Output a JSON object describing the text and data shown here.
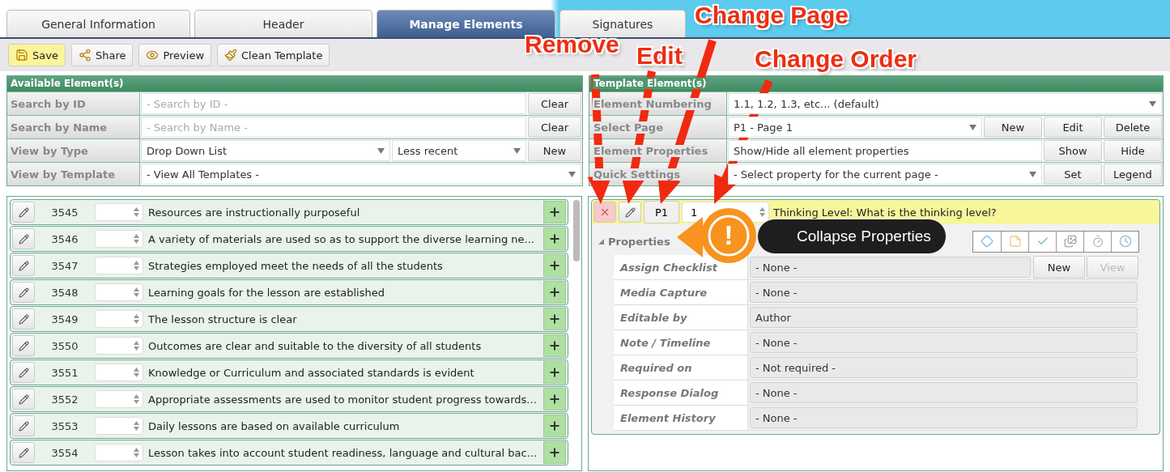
{
  "tabs": [
    {
      "label": "General Information",
      "selected": false
    },
    {
      "label": "Header",
      "selected": false
    },
    {
      "label": "Manage Elements",
      "selected": true
    },
    {
      "label": "Signatures",
      "selected": false
    }
  ],
  "toolbar": [
    {
      "label": "Save",
      "kind": "save",
      "highlighted": true
    },
    {
      "label": "Share",
      "kind": "share",
      "highlighted": false
    },
    {
      "label": "Preview",
      "kind": "preview",
      "highlighted": false
    },
    {
      "label": "Clean Template",
      "kind": "clean",
      "highlighted": false
    }
  ],
  "available": {
    "title": "Available Element(s)",
    "rows": [
      {
        "label": "Search by ID",
        "controls": [
          {
            "kind": "input",
            "placeholder": "- Search by ID -"
          },
          {
            "kind": "button",
            "label": "Clear"
          }
        ]
      },
      {
        "label": "Search by Name",
        "controls": [
          {
            "kind": "input",
            "placeholder": "- Search by Name -"
          },
          {
            "kind": "button",
            "label": "Clear"
          }
        ]
      },
      {
        "label": "View by Type",
        "controls": [
          {
            "kind": "select",
            "value": "Drop Down List"
          },
          {
            "kind": "select-narrow",
            "value": "Less recent"
          },
          {
            "kind": "button",
            "label": "New"
          }
        ]
      },
      {
        "label": "View by Template",
        "controls": [
          {
            "kind": "select",
            "value": "- View All Templates -"
          }
        ]
      }
    ]
  },
  "template": {
    "title": "Template Element(s)",
    "rows": [
      {
        "label": "Element Numbering",
        "controls": [
          {
            "kind": "select",
            "value": "1.1, 1.2, 1.3, etc... (default)"
          }
        ]
      },
      {
        "label": "Select Page",
        "controls": [
          {
            "kind": "select",
            "value": "P1 - Page 1"
          },
          {
            "kind": "button",
            "label": "New"
          },
          {
            "kind": "button",
            "label": "Edit"
          },
          {
            "kind": "button",
            "label": "Delete"
          }
        ]
      },
      {
        "label": "Element Properties",
        "controls": [
          {
            "kind": "text",
            "value": "Show/Hide all element properties"
          },
          {
            "kind": "button",
            "label": "Show"
          },
          {
            "kind": "button",
            "label": "Hide"
          }
        ]
      },
      {
        "label": "Quick Settings",
        "controls": [
          {
            "kind": "select",
            "value": "- Select property for the current page -"
          },
          {
            "kind": "button",
            "label": "Set"
          },
          {
            "kind": "button",
            "label": "Legend"
          }
        ]
      }
    ]
  },
  "elements": [
    {
      "id": "3545",
      "text": "Resources are instructionally purposeful"
    },
    {
      "id": "3546",
      "text": "A variety of materials are used so as to support the diverse learning ne..."
    },
    {
      "id": "3547",
      "text": "Strategies employed meet the needs of all the students"
    },
    {
      "id": "3548",
      "text": "Learning goals for the lesson are established"
    },
    {
      "id": "3549",
      "text": "The lesson structure is clear"
    },
    {
      "id": "3550",
      "text": "Outcomes are clear and suitable to the diversity of all students"
    },
    {
      "id": "3551",
      "text": "Knowledge or Curriculum and associated standards is evident"
    },
    {
      "id": "3552",
      "text": "Appropriate assessments are used to monitor student progress towards..."
    },
    {
      "id": "3553",
      "text": "Daily lessons are based on available curriculum"
    },
    {
      "id": "3554",
      "text": "Lesson takes into account student readiness, language and cultural bac..."
    }
  ],
  "template_element": {
    "page": "P1",
    "order": "1",
    "text": "Thinking Level: What is the thinking level?",
    "properties_label": "Properties",
    "expanded": true,
    "properties": [
      {
        "label": "Assign Checklist",
        "value": "- None -",
        "buttons": [
          {
            "label": "New",
            "disabled": false
          },
          {
            "label": "View",
            "disabled": true
          }
        ]
      },
      {
        "label": "Media Capture",
        "value": "- None -"
      },
      {
        "label": "Editable by",
        "value": "Author"
      },
      {
        "label": "Note / Timeline",
        "value": "- None -"
      },
      {
        "label": "Required on",
        "value": "- Not required -"
      },
      {
        "label": "Response Dialog",
        "value": "- None -"
      },
      {
        "label": "Element History",
        "value": "- None -"
      }
    ]
  },
  "annotations": [
    {
      "label": "Remove"
    },
    {
      "label": "Edit"
    },
    {
      "label": "Change Page"
    },
    {
      "label": "Change Order"
    }
  ],
  "callout": {
    "mark": "!",
    "text": "Collapse Properties"
  }
}
